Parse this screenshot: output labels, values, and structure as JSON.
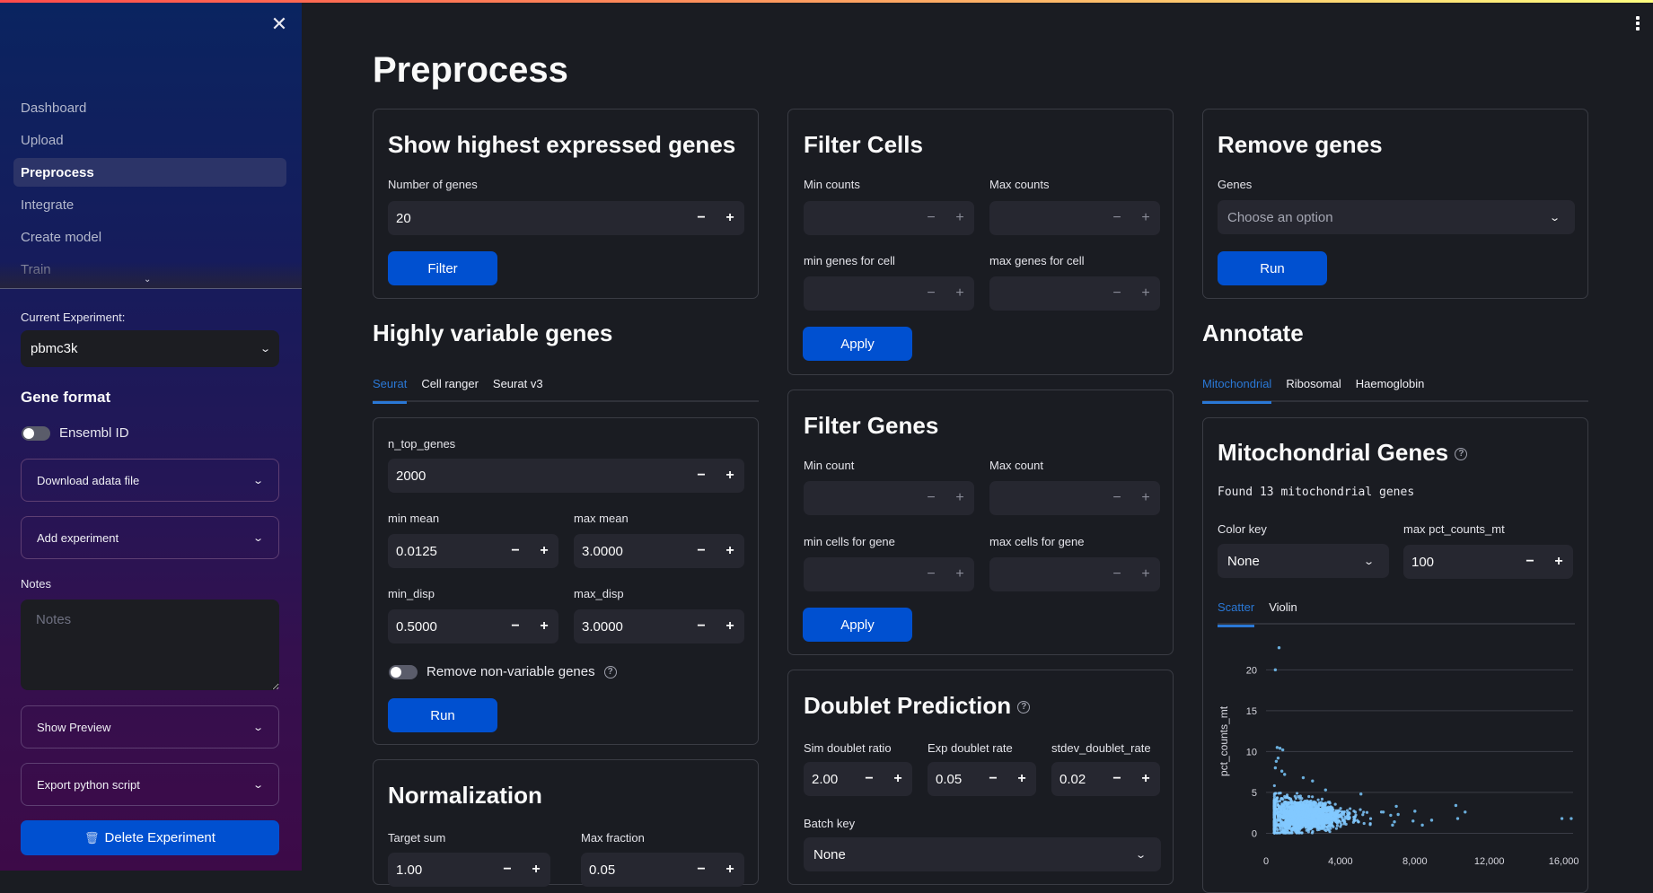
{
  "colors": {
    "accent": "#0050d0",
    "tab_active": "#2a78d6",
    "point": "#83c9ff"
  },
  "sidebar": {
    "close_icon": "close-icon",
    "nav": [
      {
        "label": "Dashboard",
        "active": false
      },
      {
        "label": "Upload",
        "active": false
      },
      {
        "label": "Preprocess",
        "active": true
      },
      {
        "label": "Integrate",
        "active": false
      },
      {
        "label": "Create model",
        "active": false
      },
      {
        "label": "Train",
        "active": false
      }
    ],
    "current_experiment_label": "Current Experiment:",
    "current_experiment_value": "pbmc3k",
    "gene_format_heading": "Gene format",
    "ensembl_toggle_label": "Ensembl ID",
    "ensembl_toggle_on": false,
    "expander_download": "Download adata file",
    "expander_add": "Add experiment",
    "notes_label": "Notes",
    "notes_placeholder": "Notes",
    "expander_preview": "Show Preview",
    "expander_export": "Export python script",
    "delete_icon": "🗑",
    "delete_label": "Delete Experiment"
  },
  "page": {
    "title": "Preprocess"
  },
  "highest_expressed": {
    "title": "Show highest expressed genes",
    "num_genes_label": "Number of genes",
    "num_genes_value": "20",
    "button": "Filter"
  },
  "hvg": {
    "title": "Highly variable genes",
    "tabs": [
      "Seurat",
      "Cell ranger",
      "Seurat v3"
    ],
    "active_tab": "Seurat",
    "n_top_genes_label": "n_top_genes",
    "n_top_genes_value": "2000",
    "min_mean_label": "min mean",
    "min_mean_value": "0.0125",
    "max_mean_label": "max mean",
    "max_mean_value": "3.0000",
    "min_disp_label": "min_disp",
    "min_disp_value": "0.5000",
    "max_disp_label": "max_disp",
    "max_disp_value": "3.0000",
    "remove_toggle_label": "Remove non-variable genes",
    "remove_toggle_on": false,
    "button": "Run"
  },
  "normalization": {
    "title": "Normalization",
    "target_sum_label": "Target sum",
    "target_sum_value": "1.00",
    "max_fraction_label": "Max fraction",
    "max_fraction_value": "0.05"
  },
  "filter_cells": {
    "title": "Filter Cells",
    "min_counts_label": "Min counts",
    "max_counts_label": "Max counts",
    "min_genes_label": "min genes for cell",
    "max_genes_label": "max genes for cell",
    "button": "Apply"
  },
  "filter_genes": {
    "title": "Filter Genes",
    "min_count_label": "Min count",
    "max_count_label": "Max count",
    "min_cells_label": "min cells for gene",
    "max_cells_label": "max cells for gene",
    "button": "Apply"
  },
  "doublet": {
    "title": "Doublet Prediction",
    "sim_ratio_label": "Sim doublet ratio",
    "sim_ratio_value": "2.00",
    "exp_rate_label": "Exp doublet rate",
    "exp_rate_value": "0.05",
    "stdev_label": "stdev_doublet_rate",
    "stdev_value": "0.02",
    "batch_key_label": "Batch key",
    "batch_key_value": "None"
  },
  "remove_genes": {
    "title": "Remove genes",
    "genes_label": "Genes",
    "genes_placeholder": "Choose an option",
    "button": "Run"
  },
  "annotate": {
    "title": "Annotate",
    "tabs": [
      "Mitochondrial",
      "Ribosomal",
      "Haemoglobin"
    ],
    "active_tab": "Mitochondrial",
    "mito": {
      "title": "Mitochondrial Genes",
      "found_text": "Found 13 mitochondrial genes",
      "color_key_label": "Color key",
      "color_key_value": "None",
      "max_pct_label": "max pct_counts_mt",
      "max_pct_value": "100",
      "plot_tabs": [
        "Scatter",
        "Violin"
      ],
      "active_plot_tab": "Scatter"
    }
  },
  "chart_data": {
    "type": "scatter",
    "title": "",
    "xlabel": "",
    "ylabel": "pct_counts_mt",
    "xlim": [
      0,
      16500
    ],
    "ylim": [
      -0.5,
      23
    ],
    "x_ticks": [
      0,
      4000,
      8000,
      12000,
      16000
    ],
    "x_tick_labels": [
      "0",
      "4,000",
      "8,000",
      "12,000",
      "16,000"
    ],
    "y_ticks": [
      0,
      5,
      10,
      15,
      20
    ],
    "y_tick_labels": [
      "0",
      "5",
      "10",
      "15",
      "20"
    ],
    "grid": true,
    "point_color": "#83c9ff",
    "description": "Dense cluster of ~2700 cells with total_counts 500-5000 and pct_counts_mt 0-5; outliers listed below",
    "outliers": [
      {
        "x": 700,
        "y": 22.7
      },
      {
        "x": 500,
        "y": 20.0
      },
      {
        "x": 600,
        "y": 10.5
      },
      {
        "x": 750,
        "y": 10.4
      },
      {
        "x": 900,
        "y": 10.2
      },
      {
        "x": 650,
        "y": 9.2
      },
      {
        "x": 550,
        "y": 8.8
      },
      {
        "x": 500,
        "y": 8.0
      },
      {
        "x": 850,
        "y": 7.6
      },
      {
        "x": 1000,
        "y": 7.2
      },
      {
        "x": 2000,
        "y": 6.8
      },
      {
        "x": 2500,
        "y": 6.4
      },
      {
        "x": 3200,
        "y": 5.3
      },
      {
        "x": 5100,
        "y": 4.8
      },
      {
        "x": 6300,
        "y": 2.6
      },
      {
        "x": 6700,
        "y": 2.2
      },
      {
        "x": 7000,
        "y": 3.3
      },
      {
        "x": 7100,
        "y": 2.3
      },
      {
        "x": 6900,
        "y": 1.4
      },
      {
        "x": 6800,
        "y": 1.0
      },
      {
        "x": 8000,
        "y": 2.7
      },
      {
        "x": 7900,
        "y": 1.5
      },
      {
        "x": 8400,
        "y": 1.0
      },
      {
        "x": 8900,
        "y": 1.6
      },
      {
        "x": 10200,
        "y": 3.4
      },
      {
        "x": 10300,
        "y": 1.8
      },
      {
        "x": 10700,
        "y": 2.6
      },
      {
        "x": 15900,
        "y": 1.8
      },
      {
        "x": 16400,
        "y": 1.8
      }
    ]
  }
}
